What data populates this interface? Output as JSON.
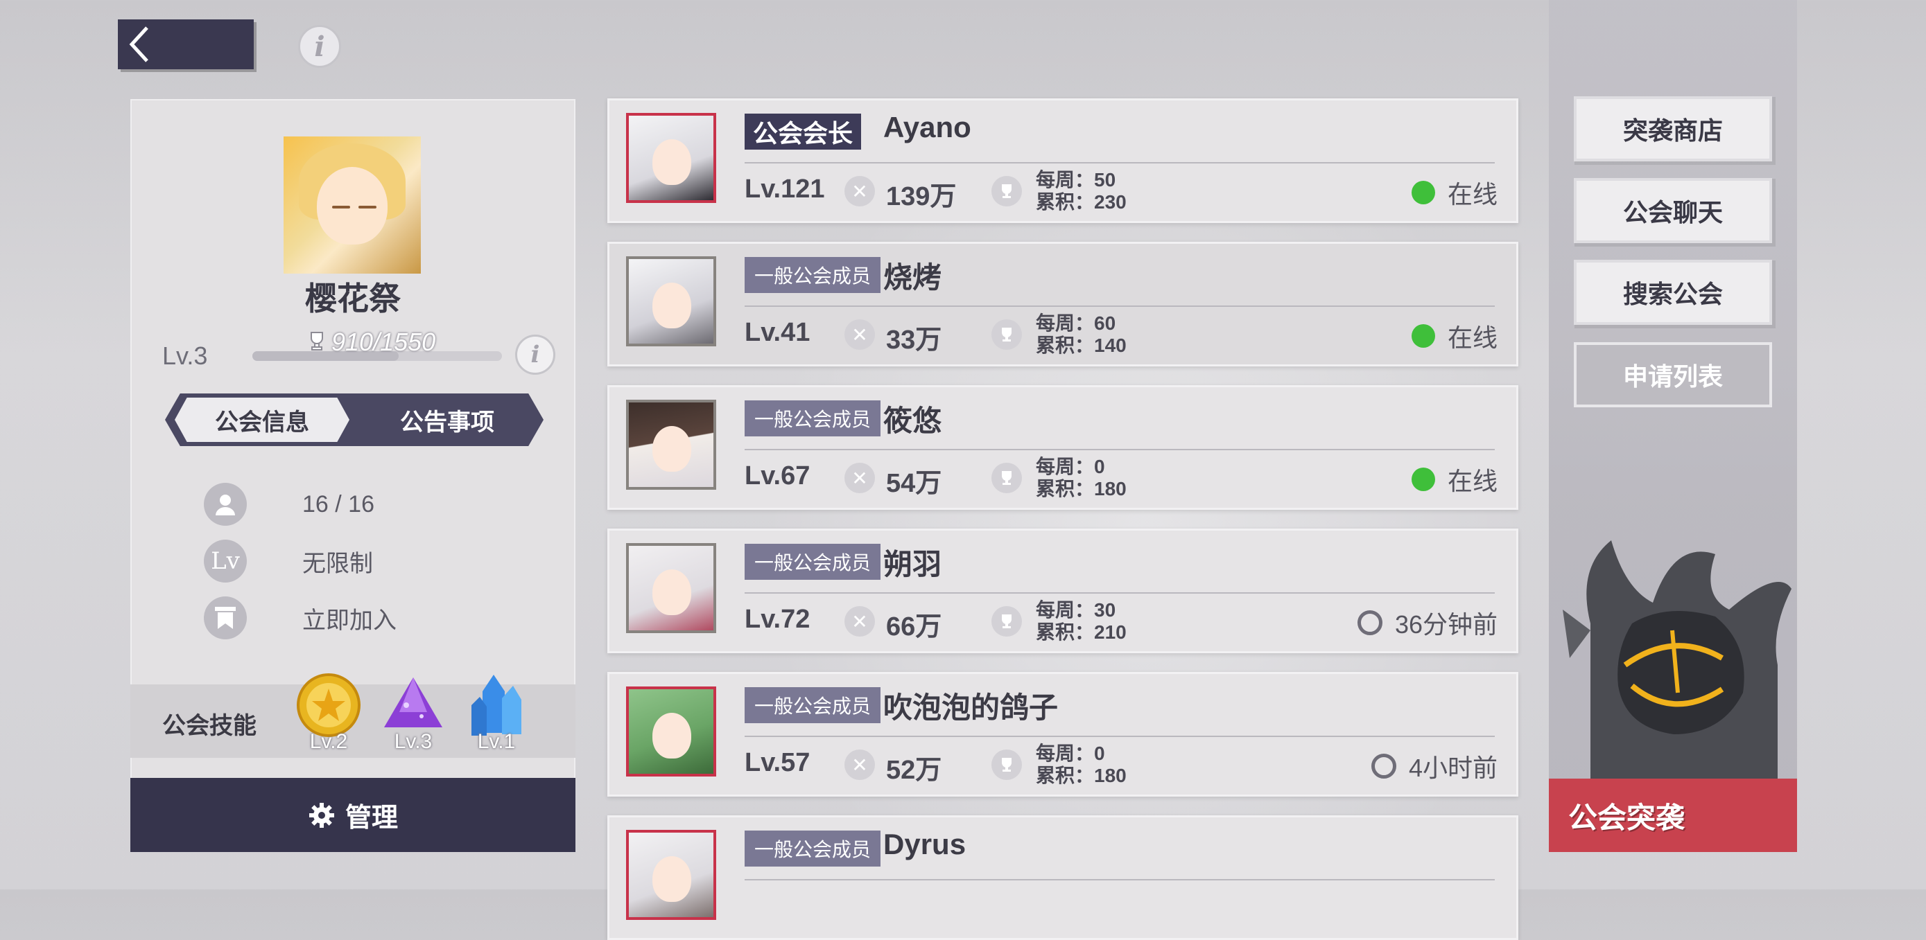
{
  "header": {
    "back_icon": "chevron-left-icon",
    "info_icon_label": "i"
  },
  "guild": {
    "name": "樱花祭",
    "level": "Lv.3",
    "xp_text": "910/1550",
    "xp_progress": 0.587,
    "info_icon_label": "i",
    "tabs": [
      {
        "label": "公会信息",
        "active": true
      },
      {
        "label": "公告事项",
        "active": false
      }
    ],
    "stats": [
      {
        "icon": "member-icon",
        "value": "16 / 16"
      },
      {
        "icon": "level-icon",
        "icon_text": "Lv",
        "value": "无限制"
      },
      {
        "icon": "join-icon",
        "value": "立即加入"
      }
    ],
    "skills_label": "公会技能",
    "skills": [
      {
        "icon": "gold-coin-icon",
        "level": "Lv.2"
      },
      {
        "icon": "purple-crystal-icon",
        "level": "Lv.3"
      },
      {
        "icon": "blue-crystal-icon",
        "level": "Lv.1"
      }
    ],
    "manage_label": "管理"
  },
  "members": [
    {
      "role": "公会会长",
      "name": "Ayano",
      "level": "Lv.121",
      "power": "139万",
      "weekly": "每周：50",
      "total": "累积：230",
      "status": "在线",
      "online": true
    },
    {
      "role": "一般公会成员",
      "name": "烧烤",
      "level": "Lv.41",
      "power": "33万",
      "weekly": "每周：60",
      "total": "累积：140",
      "status": "在线",
      "online": true
    },
    {
      "role": "一般公会成员",
      "name": "筱悠",
      "level": "Lv.67",
      "power": "54万",
      "weekly": "每周：0",
      "total": "累积：180",
      "status": "在线",
      "online": true
    },
    {
      "role": "一般公会成员",
      "name": "朔羽",
      "level": "Lv.72",
      "power": "66万",
      "weekly": "每周：30",
      "total": "累积：210",
      "status": "36分钟前",
      "online": false
    },
    {
      "role": "一般公会成员",
      "name": "吹泡泡的鸽子",
      "level": "Lv.57",
      "power": "52万",
      "weekly": "每周：0",
      "total": "累积：180",
      "status": "4小时前",
      "online": false
    },
    {
      "role": "一般公会成员",
      "name": "Dyrus"
    }
  ],
  "side_buttons": [
    "突袭商店",
    "公会聊天",
    "搜索公会",
    "申请列表"
  ],
  "raid_label": "公会突袭",
  "colors": {
    "online": "#3fbf3a",
    "leader_badge": "#3d3b58",
    "member_badge": "#7a7894",
    "raid": "#c8424e",
    "dark_panel": "#36344c"
  }
}
